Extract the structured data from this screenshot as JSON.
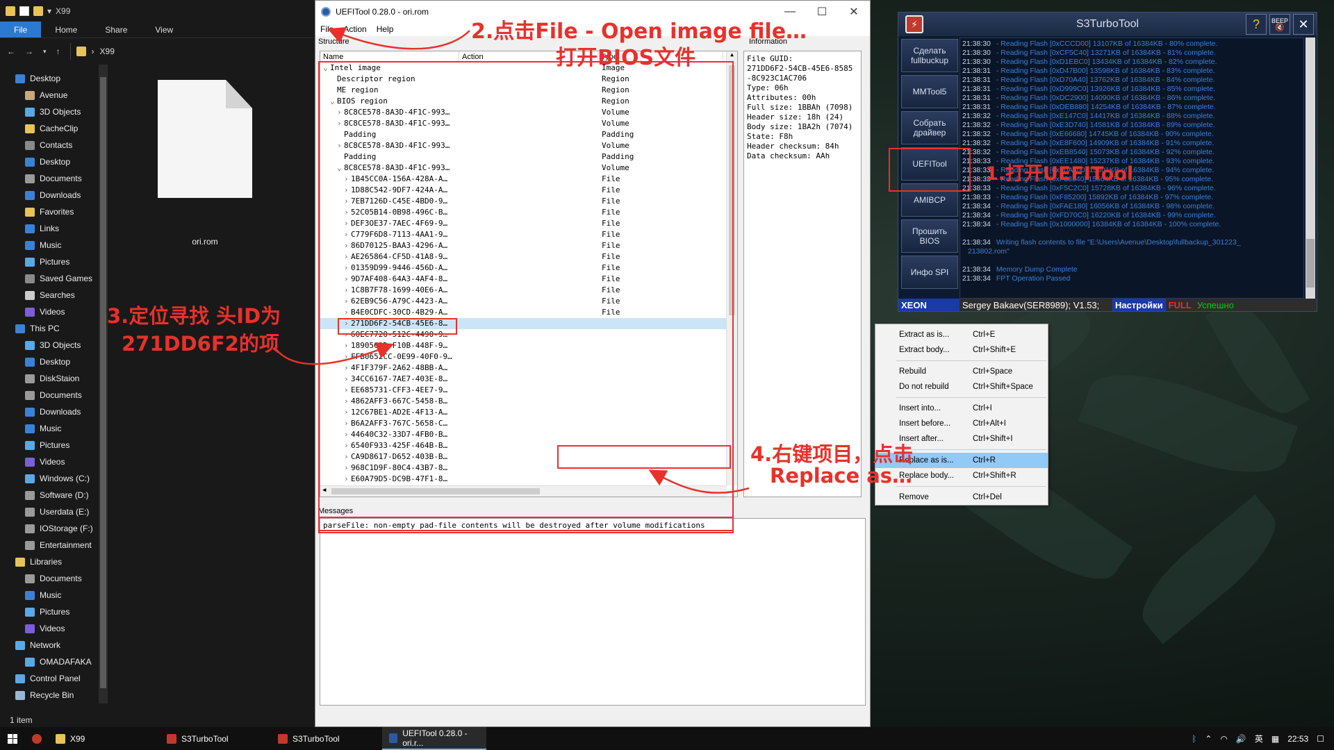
{
  "explorer": {
    "title": "X99",
    "ribbon_tabs": [
      "File",
      "Home",
      "Share",
      "View"
    ],
    "address": "X99",
    "nav_items": [
      {
        "label": "Desktop",
        "icon": "desktop-icon",
        "indent": 0,
        "color": "#3b82d6"
      },
      {
        "label": "Avenue",
        "icon": "user-icon",
        "indent": 1,
        "color": "#c9a77a"
      },
      {
        "label": "3D Objects",
        "icon": "cube-icon",
        "indent": 1,
        "color": "#5aa9e6"
      },
      {
        "label": "CacheClip",
        "icon": "folder-icon",
        "indent": 1,
        "color": "#e8c35a"
      },
      {
        "label": "Contacts",
        "icon": "contacts-icon",
        "indent": 1,
        "color": "#8a8a8a"
      },
      {
        "label": "Desktop",
        "icon": "desktop-icon",
        "indent": 1,
        "color": "#3b82d6"
      },
      {
        "label": "Documents",
        "icon": "documents-icon",
        "indent": 1,
        "color": "#9a9a9a"
      },
      {
        "label": "Downloads",
        "icon": "download-icon",
        "indent": 1,
        "color": "#3b82d6"
      },
      {
        "label": "Favorites",
        "icon": "star-icon",
        "indent": 1,
        "color": "#e8c35a"
      },
      {
        "label": "Links",
        "icon": "links-icon",
        "indent": 1,
        "color": "#3b82d6"
      },
      {
        "label": "Music",
        "icon": "music-icon",
        "indent": 1,
        "color": "#3b82d6"
      },
      {
        "label": "Pictures",
        "icon": "pictures-icon",
        "indent": 1,
        "color": "#5aa9e6"
      },
      {
        "label": "Saved Games",
        "icon": "games-icon",
        "indent": 1,
        "color": "#8a8a8a"
      },
      {
        "label": "Searches",
        "icon": "search-icon",
        "indent": 1,
        "color": "#cccccc"
      },
      {
        "label": "Videos",
        "icon": "videos-icon",
        "indent": 1,
        "color": "#7a5fd6"
      },
      {
        "label": "This PC",
        "icon": "pc-icon",
        "indent": 0,
        "color": "#3b82d6"
      },
      {
        "label": "3D Objects",
        "icon": "cube-icon",
        "indent": 1,
        "color": "#5aa9e6"
      },
      {
        "label": "Desktop",
        "icon": "desktop-icon",
        "indent": 1,
        "color": "#3b82d6"
      },
      {
        "label": "DiskStaion",
        "icon": "drive-icon",
        "indent": 1,
        "color": "#9a9a9a"
      },
      {
        "label": "Documents",
        "icon": "documents-icon",
        "indent": 1,
        "color": "#9a9a9a"
      },
      {
        "label": "Downloads",
        "icon": "download-icon",
        "indent": 1,
        "color": "#3b82d6"
      },
      {
        "label": "Music",
        "icon": "music-icon",
        "indent": 1,
        "color": "#3b82d6"
      },
      {
        "label": "Pictures",
        "icon": "pictures-icon",
        "indent": 1,
        "color": "#5aa9e6"
      },
      {
        "label": "Videos",
        "icon": "videos-icon",
        "indent": 1,
        "color": "#7a5fd6"
      },
      {
        "label": "Windows (C:)",
        "icon": "drive-icon",
        "indent": 1,
        "color": "#5aa9e6"
      },
      {
        "label": "Software (D:)",
        "icon": "drive-icon",
        "indent": 1,
        "color": "#9a9a9a"
      },
      {
        "label": "Userdata (E:)",
        "icon": "drive-icon",
        "indent": 1,
        "color": "#9a9a9a"
      },
      {
        "label": "IOStorage (F:)",
        "icon": "drive-icon",
        "indent": 1,
        "color": "#9a9a9a"
      },
      {
        "label": "Entertainment",
        "icon": "drive-icon",
        "indent": 1,
        "color": "#9a9a9a"
      },
      {
        "label": "Libraries",
        "icon": "libraries-icon",
        "indent": 0,
        "color": "#e8c35a"
      },
      {
        "label": "Documents",
        "icon": "documents-icon",
        "indent": 1,
        "color": "#9a9a9a"
      },
      {
        "label": "Music",
        "icon": "music-icon",
        "indent": 1,
        "color": "#3b82d6"
      },
      {
        "label": "Pictures",
        "icon": "pictures-icon",
        "indent": 1,
        "color": "#5aa9e6"
      },
      {
        "label": "Videos",
        "icon": "videos-icon",
        "indent": 1,
        "color": "#7a5fd6"
      },
      {
        "label": "Network",
        "icon": "network-icon",
        "indent": 0,
        "color": "#5aa9e6"
      },
      {
        "label": "OMADAFAKA",
        "icon": "pc-icon",
        "indent": 1,
        "color": "#5aa9e6"
      },
      {
        "label": "Control Panel",
        "icon": "control-panel-icon",
        "indent": 0,
        "color": "#5aa9e6"
      },
      {
        "label": "Recycle Bin",
        "icon": "recycle-bin-icon",
        "indent": 0,
        "color": "#9ab8d6"
      }
    ],
    "file_name": "ori.rom",
    "status": "1 item"
  },
  "uefitool": {
    "title": "UEFITool 0.28.0 - ori.rom",
    "menu": [
      "File",
      "Action",
      "Help"
    ],
    "structure_label": "Structure",
    "information_label": "Information",
    "messages_label": "Messages",
    "columns": [
      "Name",
      "Action",
      "Type"
    ],
    "tree": [
      {
        "name": "Intel image",
        "type": "Image",
        "depth": 0,
        "arrow": "v"
      },
      {
        "name": "Descriptor region",
        "type": "Region",
        "depth": 1,
        "arrow": ""
      },
      {
        "name": "ME region",
        "type": "Region",
        "depth": 1,
        "arrow": ""
      },
      {
        "name": "BIOS region",
        "type": "Region",
        "depth": 1,
        "arrow": "v"
      },
      {
        "name": "8C8CE578-8A3D-4F1C-993…",
        "type": "Volume",
        "depth": 2,
        "arrow": ">"
      },
      {
        "name": "8C8CE578-8A3D-4F1C-993…",
        "type": "Volume",
        "depth": 2,
        "arrow": ">"
      },
      {
        "name": "Padding",
        "type": "Padding",
        "depth": 2,
        "arrow": ""
      },
      {
        "name": "8C8CE578-8A3D-4F1C-993…",
        "type": "Volume",
        "depth": 2,
        "arrow": ">"
      },
      {
        "name": "Padding",
        "type": "Padding",
        "depth": 2,
        "arrow": ""
      },
      {
        "name": "8C8CE578-8A3D-4F1C-993…",
        "type": "Volume",
        "depth": 2,
        "arrow": "v"
      },
      {
        "name": "1B45CC0A-156A-428A-A…",
        "type": "File",
        "depth": 3,
        "arrow": ">"
      },
      {
        "name": "1D88C542-9DF7-424A-A…",
        "type": "File",
        "depth": 3,
        "arrow": ">"
      },
      {
        "name": "7EB7126D-C45E-4BD0-9…",
        "type": "File",
        "depth": 3,
        "arrow": ">"
      },
      {
        "name": "52C05B14-0B98-496C-B…",
        "type": "File",
        "depth": 3,
        "arrow": ">"
      },
      {
        "name": "DEF3OE37-7AEC-4F69-9…",
        "type": "File",
        "depth": 3,
        "arrow": ">"
      },
      {
        "name": "C779F6D8-7113-4AA1-9…",
        "type": "File",
        "depth": 3,
        "arrow": ">"
      },
      {
        "name": "86D70125-BAA3-4296-A…",
        "type": "File",
        "depth": 3,
        "arrow": ">"
      },
      {
        "name": "AE265864-CF5D-41A8-9…",
        "type": "File",
        "depth": 3,
        "arrow": ">"
      },
      {
        "name": "01359D99-9446-456D-A…",
        "type": "File",
        "depth": 3,
        "arrow": ">"
      },
      {
        "name": "9D7AF408-64A3-4AF4-8…",
        "type": "File",
        "depth": 3,
        "arrow": ">"
      },
      {
        "name": "1C8B7F78-1699-40E6-A…",
        "type": "File",
        "depth": 3,
        "arrow": ">"
      },
      {
        "name": "62EB9C56-A79C-4423-A…",
        "type": "File",
        "depth": 3,
        "arrow": ">"
      },
      {
        "name": "B4E0CDFC-30CD-4B29-A…",
        "type": "File",
        "depth": 3,
        "arrow": ">"
      },
      {
        "name": "271DD6F2-54CB-45E6-8…",
        "type": "",
        "depth": 3,
        "arrow": ">",
        "selected": true
      },
      {
        "name": "60EC7720-512C-4490-9…",
        "type": "",
        "depth": 3,
        "arrow": ">"
      },
      {
        "name": "1890562D-F10B-448F-9…",
        "type": "",
        "depth": 3,
        "arrow": ">"
      },
      {
        "name": "FFB0652CC-0E99-40F0-9…",
        "type": "",
        "depth": 3,
        "arrow": ">"
      },
      {
        "name": "4F1F379F-2A62-48BB-A…",
        "type": "",
        "depth": 3,
        "arrow": ">"
      },
      {
        "name": "34CC6167-7AE7-403E-8…",
        "type": "",
        "depth": 3,
        "arrow": ">"
      },
      {
        "name": "EE685731-CFF3-4EE7-9…",
        "type": "",
        "depth": 3,
        "arrow": ">"
      },
      {
        "name": "4862AFF3-667C-5458-B…",
        "type": "",
        "depth": 3,
        "arrow": ">"
      },
      {
        "name": "12C67BE1-AD2E-4F13-A…",
        "type": "",
        "depth": 3,
        "arrow": ">"
      },
      {
        "name": "B6A2AFF3-767C-5658-C…",
        "type": "",
        "depth": 3,
        "arrow": ">"
      },
      {
        "name": "44640C32-33D7-4FB0-B…",
        "type": "",
        "depth": 3,
        "arrow": ">"
      },
      {
        "name": "6540F933-425F-464B-B…",
        "type": "",
        "depth": 3,
        "arrow": ">"
      },
      {
        "name": "CA9D8617-D652-403B-B…",
        "type": "",
        "depth": 3,
        "arrow": ">"
      },
      {
        "name": "968C1D9F-80C4-43B7-8…",
        "type": "",
        "depth": 3,
        "arrow": ">"
      },
      {
        "name": "E60A79D5-DC9B-47F1-8…",
        "type": "",
        "depth": 3,
        "arrow": ">"
      }
    ],
    "info_text": "File GUID:\n271DD6F2-54CB-45E6-8585\n-8C923C1AC706\nType: 06h\nAttributes: 00h\nFull size: 1BBAh (7098)\nHeader size: 18h (24)\nBody size: 1BA2h (7074)\nState: F8h\nHeader checksum: 84h\nData checksum: AAh",
    "message": "parseFile: non-empty pad-file contents will be destroyed after volume modifications",
    "context_menu": [
      {
        "label": "Extract as is...",
        "shortcut": "Ctrl+E"
      },
      {
        "label": "Extract body...",
        "shortcut": "Ctrl+Shift+E"
      },
      {
        "sep": true
      },
      {
        "label": "Rebuild",
        "shortcut": "Ctrl+Space"
      },
      {
        "label": "Do not rebuild",
        "shortcut": "Ctrl+Shift+Space"
      },
      {
        "sep": true
      },
      {
        "label": "Insert into...",
        "shortcut": "Ctrl+I"
      },
      {
        "label": "Insert before...",
        "shortcut": "Ctrl+Alt+I"
      },
      {
        "label": "Insert after...",
        "shortcut": "Ctrl+Shift+I"
      },
      {
        "sep": true
      },
      {
        "label": "Replace as is...",
        "shortcut": "Ctrl+R",
        "highlight": true
      },
      {
        "label": "Replace body...",
        "shortcut": "Ctrl+Shift+R"
      },
      {
        "sep": true
      },
      {
        "label": "Remove",
        "shortcut": "Ctrl+Del"
      }
    ]
  },
  "s3turbotool": {
    "title": "S3TurboTool",
    "beep_label": "BEEP",
    "buttons": [
      "Сделать fullbuckup",
      "MMTool5",
      "Собрать драйвер",
      "UEFITool",
      "AMIBCP",
      "Прошить BIOS",
      "Инфо SPI"
    ],
    "log": [
      {
        "t": "21:38:30",
        "m": "- Reading Flash [0xCCCD00] 13107KB of 16384KB - 80% complete."
      },
      {
        "t": "21:38:30",
        "m": "- Reading Flash [0xCF5C40] 13271KB of 16384KB - 81% complete."
      },
      {
        "t": "21:38:30",
        "m": "- Reading Flash [0xD1EBC0] 13434KB of 16384KB - 82% complete."
      },
      {
        "t": "21:38:31",
        "m": "- Reading Flash [0xD47B00] 13598KB of 16384KB - 83% complete."
      },
      {
        "t": "21:38:31",
        "m": "- Reading Flash [0xD70A40] 13762KB of 16384KB - 84% complete."
      },
      {
        "t": "21:38:31",
        "m": "- Reading Flash [0xD999C0] 13926KB of 16384KB - 85% complete."
      },
      {
        "t": "21:38:31",
        "m": "- Reading Flash [0xDC2900] 14090KB of 16384KB - 86% complete."
      },
      {
        "t": "21:38:31",
        "m": "- Reading Flash [0xDEB880] 14254KB of 16384KB - 87% complete."
      },
      {
        "t": "21:38:32",
        "m": "- Reading Flash [0xE147C0] 14417KB of 16384KB - 88% complete."
      },
      {
        "t": "21:38:32",
        "m": "- Reading Flash [0xE3D740] 14581KB of 16384KB - 89% complete."
      },
      {
        "t": "21:38:32",
        "m": "- Reading Flash [0xE66680] 14745KB of 16384KB - 90% complete."
      },
      {
        "t": "21:38:32",
        "m": "- Reading Flash [0xE8F600] 14909KB of 16384KB - 91% complete."
      },
      {
        "t": "21:38:32",
        "m": "- Reading Flash [0xEB8540] 15073KB of 16384KB - 92% complete."
      },
      {
        "t": "21:38:33",
        "m": "- Reading Flash [0xEE1480] 15237KB of 16384KB - 93% complete."
      },
      {
        "t": "21:38:33",
        "m": "- Reading Flash [0xF0A400] 15401KB of 16384KB - 94% complete."
      },
      {
        "t": "21:38:33",
        "m": "- Reading Flash [0xF33340] 15564KB of 16384KB - 95% complete."
      },
      {
        "t": "21:38:33",
        "m": "- Reading Flash [0xF5C2C0] 15728KB of 16384KB - 96% complete."
      },
      {
        "t": "21:38:33",
        "m": "- Reading Flash [0xF85200] 15892KB of 16384KB - 97% complete."
      },
      {
        "t": "21:38:34",
        "m": "- Reading Flash [0xFAE180] 16056KB of 16384KB - 98% complete."
      },
      {
        "t": "21:38:34",
        "m": "- Reading Flash [0xFD70C0] 16220KB of 16384KB - 99% complete."
      },
      {
        "t": "21:38:34",
        "m": "- Reading Flash [0x1000000] 16384KB of 16384KB - 100% complete."
      },
      {
        "t": "",
        "m": ""
      },
      {
        "t": "21:38:34",
        "m": "Writing flash contents to file \"E:\\Users\\Avenue\\Desktop\\fullbackup_301223_"
      },
      {
        "t": "",
        "m": "213802.rom\""
      },
      {
        "t": "",
        "m": ""
      },
      {
        "t": "21:38:34",
        "m": "Memory Dump Complete"
      },
      {
        "t": "21:38:34",
        "m": "FPT Operation Passed"
      }
    ],
    "status": {
      "cpu": "XEON",
      "author": "Sergey Bakaev(SER8989); V1.53;",
      "settings": "Настройки",
      "full": "FULL",
      "ok": "Успешно"
    }
  },
  "taskbar": {
    "items": [
      {
        "label": "X99",
        "icon": "folder-icon",
        "color": "#e8c35a"
      },
      {
        "label": "S3TurboTool",
        "icon": "s3-icon",
        "color": "#c0392b"
      },
      {
        "label": "S3TurboTool",
        "icon": "s3-icon",
        "color": "#c0392b"
      },
      {
        "label": "UEFITool 0.28.0 - ori.r...",
        "icon": "uefitool-icon",
        "color": "#2c5aa0"
      }
    ],
    "ime": "英",
    "time": "22:53"
  },
  "annotations": {
    "step1": "1.打开UEFITool",
    "step2a": "2.点击File - Open image file…",
    "step2b": "打开BIOS文件",
    "step3a": "3.定位寻找 头ID为",
    "step3b": "271DD6F2的项",
    "step4a": "4.右键项目，点击",
    "step4b": "Replace as…"
  },
  "colors": {
    "annotation": "#e8312a",
    "s3_full": "#e8312a",
    "s3_ok": "#00d000",
    "s3_settings_bg": "#1a3aa8"
  }
}
